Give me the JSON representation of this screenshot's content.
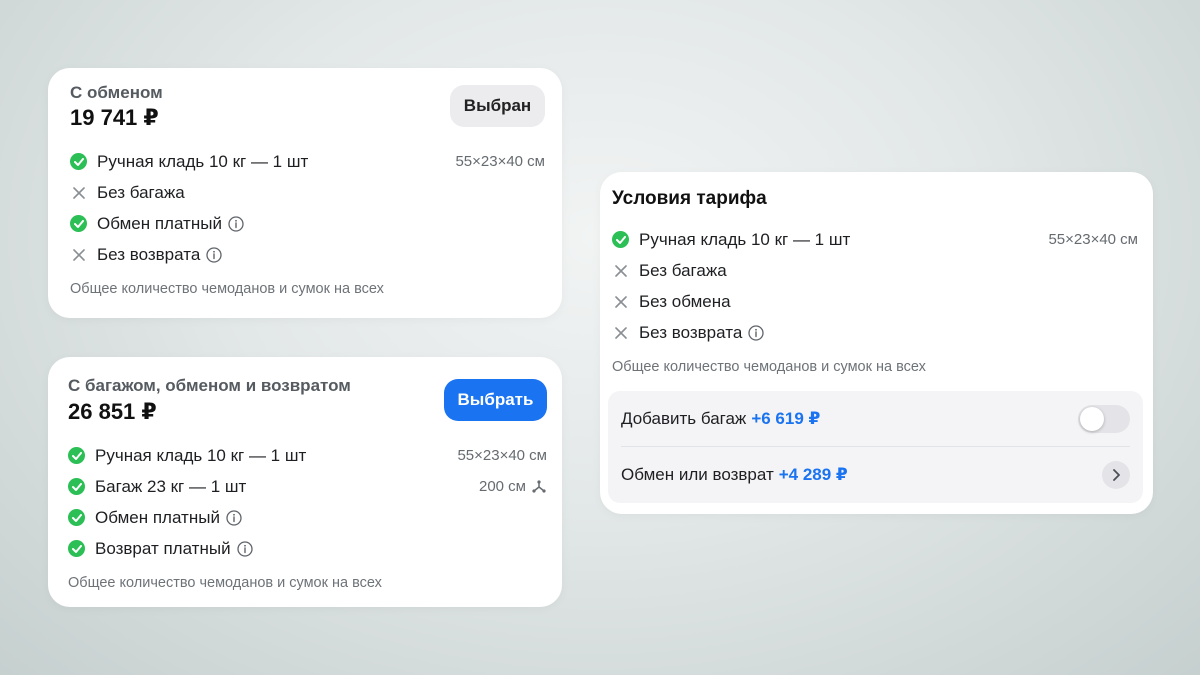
{
  "tariff_cards": [
    {
      "title": "С обменом",
      "price": "19 741 ₽",
      "button_label": "Выбран",
      "features": [
        {
          "text": "Ручная кладь 10 кг — 1 шт",
          "meta": "55×23×40 см"
        },
        {
          "text": "Без багажа"
        },
        {
          "text": "Обмен платный"
        },
        {
          "text": "Без возврата"
        }
      ],
      "note": "Общее количество чемоданов и сумок на всех"
    },
    {
      "title": "С багажом, обменом и возвратом",
      "price": "26 851 ₽",
      "button_label": "Выбрать",
      "features": [
        {
          "text": "Ручная кладь 10 кг — 1 шт",
          "meta": "55×23×40 см"
        },
        {
          "text": "Багаж 23 кг — 1 шт",
          "meta": "200 см"
        },
        {
          "text": "Обмен платный"
        },
        {
          "text": "Возврат платный"
        }
      ],
      "note": "Общее количество чемоданов и сумок на всех"
    }
  ],
  "conditions": {
    "title": "Условия тарифа",
    "features": [
      {
        "text": "Ручная кладь 10 кг — 1 шт",
        "meta": "55×23×40 см"
      },
      {
        "text": "Без багажа"
      },
      {
        "text": "Без обмена"
      },
      {
        "text": "Без возврата"
      }
    ],
    "note": "Общее количество чемоданов и сумок на всех",
    "add_baggage": {
      "label": "Добавить багаж",
      "price": "+6 619 ₽",
      "toggle_on": false
    },
    "exchange_refund": {
      "label": "Обмен или возврат",
      "price": "+4 289 ₽"
    }
  },
  "colors": {
    "accent": "#1a73f0",
    "included": "#2bbf55",
    "excluded": "#8a8f94"
  }
}
